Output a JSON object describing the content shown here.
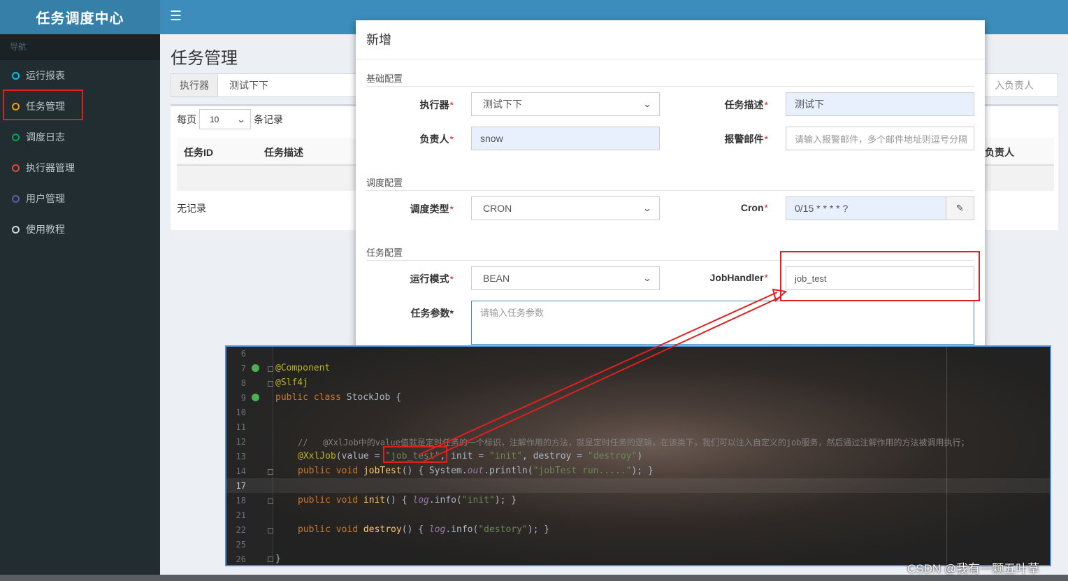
{
  "app": {
    "logo": "任务调度中心",
    "menu_icon": "hamburger-icon"
  },
  "sidebar": {
    "header": "导航",
    "items": [
      {
        "label": "运行报表",
        "color": "#00c0ef"
      },
      {
        "label": "任务管理",
        "color": "#f39c12"
      },
      {
        "label": "调度日志",
        "color": "#00a65a"
      },
      {
        "label": "执行器管理",
        "color": "#dd4b39"
      },
      {
        "label": "用户管理",
        "color": "#605ca8"
      },
      {
        "label": "使用教程",
        "color": "#d2d6de"
      }
    ]
  },
  "page": {
    "title": "任务管理",
    "filter": {
      "executor_label": "执行器",
      "executor_value": "测试下下",
      "owner_placeholder": "入负责人"
    },
    "perpage": {
      "prefix": "每页",
      "value": "10",
      "suffix": "条记录"
    },
    "table": {
      "headers": [
        "任务ID",
        "任务描述",
        "负责人"
      ],
      "empty": "无记录"
    }
  },
  "modal": {
    "title": "新增",
    "sections": {
      "basic": "基础配置",
      "schedule": "调度配置",
      "task": "任务配置"
    },
    "fields": {
      "executor": {
        "label": "执行器",
        "value": "测试下下"
      },
      "desc": {
        "label": "任务描述",
        "value": "测试下"
      },
      "owner": {
        "label": "负责人",
        "value": "snow"
      },
      "alarm": {
        "label": "报警邮件",
        "placeholder": "请输入报警邮件，多个邮件地址则逗号分隔"
      },
      "schedule_type": {
        "label": "调度类型",
        "value": "CRON"
      },
      "cron": {
        "label": "Cron",
        "value": "0/15 * * * * ?",
        "button_icon": "edit-icon"
      },
      "run_mode": {
        "label": "运行模式",
        "value": "BEAN"
      },
      "job_handler": {
        "label": "JobHandler",
        "value": "job_test"
      },
      "params": {
        "label": "任务参数",
        "placeholder": "请输入任务参数"
      }
    },
    "required_mark": "*"
  },
  "editor": {
    "line_numbers": [
      "6",
      "7",
      "8",
      "9",
      "10",
      "11",
      "12",
      "13",
      "14",
      "17",
      "18",
      "21",
      "22",
      "25",
      "26"
    ],
    "lines": {
      "l7": "@Component",
      "l8": "@Slf4j",
      "l9_kw": "public class",
      "l9_rest": " StockJob {",
      "l12": "//   @XxlJob中的value值就是定时任务的一个标识，注解作用的方法，就是定时任务的逻辑，在该类下，我们可以注入自定义的job服务，然后通过注解作用的方法被调用执行；",
      "l13_ann": "@XxlJob",
      "l13_a": "(value = ",
      "l13_s1": "\"job_test\"",
      "l13_b": ", init = ",
      "l13_s2": "\"init\"",
      "l13_c": ", destroy = ",
      "l13_s3": "\"destroy\"",
      "l13_d": ")",
      "l14_kw": "public void ",
      "l14_fn": "jobTest",
      "l14_a": "() { System.",
      "l14_it": "out",
      "l14_b": ".println(",
      "l14_s": "\"jobTest run.....\"",
      "l14_c": "); }",
      "l18_kw": "public void ",
      "l18_fn": "init",
      "l18_a": "() { ",
      "l18_it": "log",
      "l18_b": ".info(",
      "l18_s": "\"init\"",
      "l18_c": "); }",
      "l22_kw": "public void ",
      "l22_fn": "destroy",
      "l22_a": "() { ",
      "l22_it": "log",
      "l22_b": ".info(",
      "l22_s": "\"destory\"",
      "l22_c": "); }",
      "l26": "}"
    }
  },
  "watermark": "CSDN @我有一颗五叶草",
  "colors": {
    "highlight": "#e02020",
    "header": "#3c8dbc",
    "logo_bg": "#367fa9",
    "sidebar": "#222d32"
  }
}
